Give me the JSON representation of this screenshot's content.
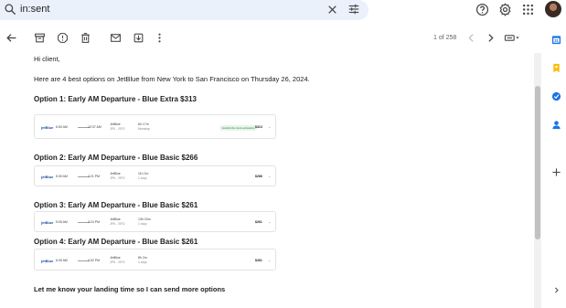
{
  "search": {
    "query": "in:sent"
  },
  "toolbar": {
    "pager": "1 of 258"
  },
  "email": {
    "greeting": "Hi client,",
    "intro": "Here are 4 best options on JetBlue from New York to San Francisco on Thursday 26, 2024.",
    "options": [
      {
        "title": "Option 1: Early AM Departure - Blue Extra $313",
        "airline": "jetBlue",
        "depart": "6:50 AM",
        "arrive": "10:37 AM",
        "col1_line1": "JetBlue",
        "col1_line2": "JFK - SFO",
        "col2_line1": "6h 17m",
        "col2_line2": "Nonstop",
        "badge": "Avoids the most emissions",
        "price": "$313"
      },
      {
        "title": "Option 2: Early AM Departure - Blue Basic $266",
        "airline": "jetBlue",
        "depart": "5:30 AM",
        "arrive": "2:21 PM",
        "col1_line1": "JetBlue",
        "col1_line2": "JFK - SFO",
        "col2_line1": "11h 1m",
        "col2_line2": "1 stop",
        "badge": "",
        "price": "$266"
      },
      {
        "title": "Option 3: Early AM Departure - Blue Basic $261",
        "airline": "jetBlue",
        "depart": "5:05 AM",
        "arrive": "3:24 PM",
        "col1_line1": "JetBlue",
        "col1_line2": "JFK - SFO",
        "col2_line1": "13h 20m",
        "col2_line2": "1 stop",
        "badge": "",
        "price": "$261"
      },
      {
        "title": "Option 4: Early AM Departure - Blue Basic $261",
        "airline": "jetBlue",
        "depart": "6:30 AM",
        "arrive": "2:32 PM",
        "col1_line1": "JetBlue",
        "col1_line2": "JFK - SFO",
        "col2_line1": "8h 2m",
        "col2_line2": "1 stop",
        "badge": "",
        "price": "$261"
      }
    ],
    "closing": "Let me know your landing time so I can send more options"
  },
  "colors": {
    "search_bg": "#eaf1fb",
    "jetblue": "#1a4ca1",
    "badge_green": "#188038",
    "calendar_blue": "#1a73e8",
    "keep_yellow": "#fbbc04"
  }
}
